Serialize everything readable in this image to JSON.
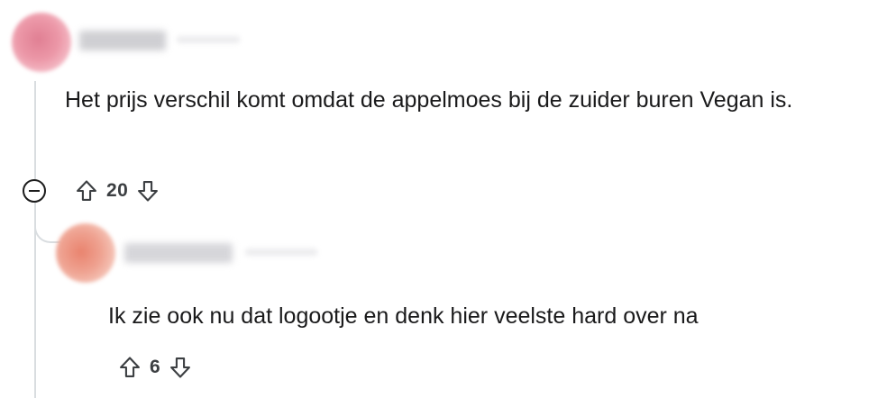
{
  "comments": [
    {
      "body": "Het prijs verschil komt omdat de appelmoes bij de zuider buren Vegan is.",
      "score": "20",
      "collapse_icon": "minus-circle-icon",
      "upvote_icon": "arrow-up-outline-icon",
      "downvote_icon": "arrow-down-outline-icon"
    },
    {
      "body": "Ik zie ook nu dat logootje en denk hier veelste hard over na",
      "score": "6",
      "upvote_icon": "arrow-up-outline-icon",
      "downvote_icon": "arrow-down-outline-icon"
    }
  ],
  "colors": {
    "text": "#1a1a1b",
    "thread_line": "#d9dde0",
    "icon": "#3c3f42"
  }
}
